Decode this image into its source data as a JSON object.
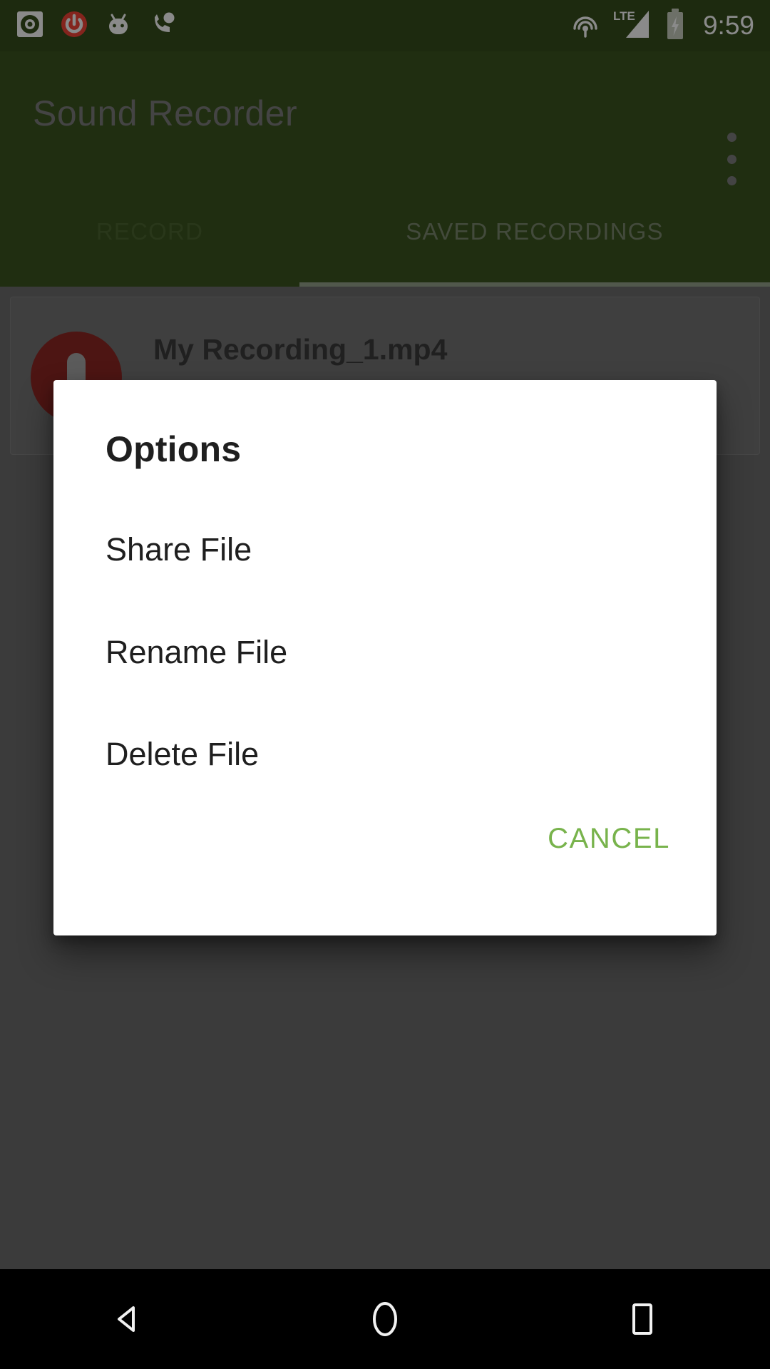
{
  "status_bar": {
    "time": "9:59",
    "left_icons": [
      {
        "name": "screen-recorder-icon",
        "label": "screen recorder"
      },
      {
        "name": "power-icon",
        "label": "power"
      },
      {
        "name": "android-head-icon",
        "label": "android"
      },
      {
        "name": "call-icon",
        "label": "call"
      }
    ],
    "right_icons": [
      {
        "name": "cast-icon",
        "label": "cast"
      },
      {
        "name": "lte-signal-icon",
        "label": "LTE"
      },
      {
        "name": "battery-charging-icon",
        "label": "battery charging"
      }
    ],
    "lte_label": "LTE"
  },
  "app_bar": {
    "title": "Sound Recorder",
    "overflow_label": "More options"
  },
  "tabs": [
    {
      "id": "record",
      "label": "RECORD",
      "selected": false
    },
    {
      "id": "saved",
      "label": "SAVED RECORDINGS",
      "selected": true
    }
  ],
  "recordings": [
    {
      "name": "My Recording_1.mp4"
    }
  ],
  "dialog": {
    "title": "Options",
    "options": [
      {
        "id": "share",
        "label": "Share File"
      },
      {
        "id": "rename",
        "label": "Rename File"
      },
      {
        "id": "delete",
        "label": "Delete File"
      }
    ],
    "cancel_label": "CANCEL"
  },
  "nav_bar": {
    "back_label": "Back",
    "home_label": "Home",
    "recents_label": "Recents"
  },
  "colors": {
    "status_bar": "#364f1c",
    "app_bar": "#3c5520",
    "accent_green": "#78b34c",
    "avatar_red": "#8e2723",
    "dialog_bg": "#ffffff",
    "scrim": "rgba(0,0,0,0.46)"
  }
}
